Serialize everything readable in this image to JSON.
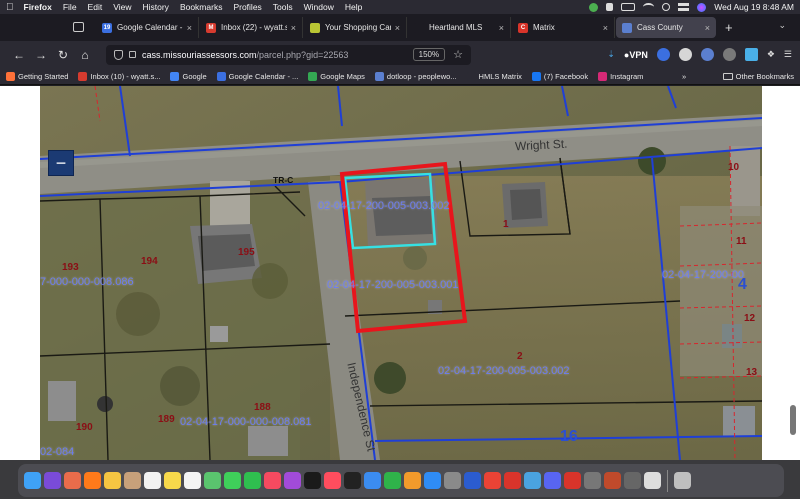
{
  "menubar": {
    "app_name": "Firefox",
    "items": [
      "File",
      "Edit",
      "View",
      "History",
      "Bookmarks",
      "Profiles",
      "Tools",
      "Window",
      "Help"
    ],
    "clock": "Wed Aug 19  8:48 AM"
  },
  "tabs": [
    {
      "title": "Google Calendar - W",
      "favicon_color": "#3b6fe0",
      "favicon_text": "19"
    },
    {
      "title": "Inbox (22) - wyatt.s",
      "favicon_color": "#d63b2f",
      "favicon_text": "M"
    },
    {
      "title": "Your Shopping Cart",
      "favicon_color": "#b9c534",
      "favicon_text": ""
    },
    {
      "title": "Heartland MLS",
      "favicon_color": "#1c1b22",
      "favicon_text": ""
    },
    {
      "title": "Matrix",
      "favicon_color": "#d8342a",
      "favicon_text": "C"
    },
    {
      "title": "Cass County",
      "favicon_color": "#5b7fcf",
      "favicon_text": "",
      "active": true
    }
  ],
  "navbar": {
    "url_host": "cass.missouriassessors.com",
    "url_path": "/parcel.php?gid=22563",
    "zoom": "150%",
    "vpn_label": "VPN"
  },
  "bookmarks": {
    "items": [
      {
        "label": "Getting Started",
        "icon_color": "#ff7139"
      },
      {
        "label": "Inbox (10) - wyatt.s...",
        "icon_color": "#d63b2f"
      },
      {
        "label": "Google",
        "icon_color": "#4285f4"
      },
      {
        "label": "Google Calendar - ...",
        "icon_color": "#3b6fe0"
      },
      {
        "label": "Google Maps",
        "icon_color": "#34a853"
      },
      {
        "label": "dotloop - peoplewo...",
        "icon_color": "#5b7fcf"
      },
      {
        "label": "HMLS Matrix",
        "icon_color": "#2b2a33"
      },
      {
        "label": "(7) Facebook",
        "icon_color": "#1877f2"
      },
      {
        "label": "Instagram",
        "icon_color": "#d62976"
      }
    ],
    "other": "Other Bookmarks"
  },
  "map": {
    "zoom_out_label": "−",
    "parcel_labels": [
      "02-04-17-200-005-003.002",
      "02-04-17-200-005-003.001",
      "02-04-17-200-005-003.002",
      "02-04-17-200-00",
      "7-000-000-008.086",
      "02-04-17-000-000-008.081",
      "02-084"
    ],
    "lot_numbers": [
      "193",
      "194",
      "195",
      "189",
      "188",
      "190",
      "1",
      "2",
      "10",
      "11",
      "12",
      "13"
    ],
    "big_numbers": [
      "4",
      "16"
    ],
    "streets": [
      "Wright St.",
      "Independence St"
    ],
    "zoning_label": "TR-C"
  },
  "dock": {
    "apps": [
      {
        "name": "Finder",
        "color": "#3fa2f7"
      },
      {
        "name": "Siri",
        "color": "#7a4bd8"
      },
      {
        "name": "Launchpad",
        "color": "#e96c4b"
      },
      {
        "name": "Firefox",
        "color": "#ff7a1a"
      },
      {
        "name": "Photos",
        "color": "#f5c542"
      },
      {
        "name": "Contacts",
        "color": "#c7a07a"
      },
      {
        "name": "Calendar",
        "color": "#f2f2f2"
      },
      {
        "name": "Notes",
        "color": "#f7d84b"
      },
      {
        "name": "Reminders",
        "color": "#f4f4f4"
      },
      {
        "name": "Maps",
        "color": "#5ac46e"
      },
      {
        "name": "Messages",
        "color": "#3fcf5a"
      },
      {
        "name": "FaceTime",
        "color": "#2fbf4f"
      },
      {
        "name": "Music",
        "color": "#f54a60"
      },
      {
        "name": "Podcasts",
        "color": "#a24bd8"
      },
      {
        "name": "TV",
        "color": "#1a1a1a"
      },
      {
        "name": "News",
        "color": "#ff4d5e"
      },
      {
        "name": "Stocks",
        "color": "#222"
      },
      {
        "name": "Keynote",
        "color": "#3b8cf0"
      },
      {
        "name": "Numbers",
        "color": "#2fb34a"
      },
      {
        "name": "Pages",
        "color": "#f29a2b"
      },
      {
        "name": "App Store",
        "color": "#2f8cf5"
      },
      {
        "name": "System Preferences",
        "color": "#8a8a8a"
      },
      {
        "name": "Word",
        "color": "#2b5ccf"
      },
      {
        "name": "Chrome",
        "color": "#ea4335"
      },
      {
        "name": "Acrobat",
        "color": "#d9342b"
      },
      {
        "name": "Preview",
        "color": "#4aa3e0"
      },
      {
        "name": "Other1",
        "color": "#5865f2"
      },
      {
        "name": "Other2",
        "color": "#d8342a"
      },
      {
        "name": "Other3",
        "color": "#777"
      },
      {
        "name": "Other4",
        "color": "#c04a2b"
      },
      {
        "name": "Other5",
        "color": "#666"
      },
      {
        "name": "Other6",
        "color": "#ddd"
      },
      {
        "name": "Trash",
        "color": "#bfbfbf"
      }
    ]
  }
}
